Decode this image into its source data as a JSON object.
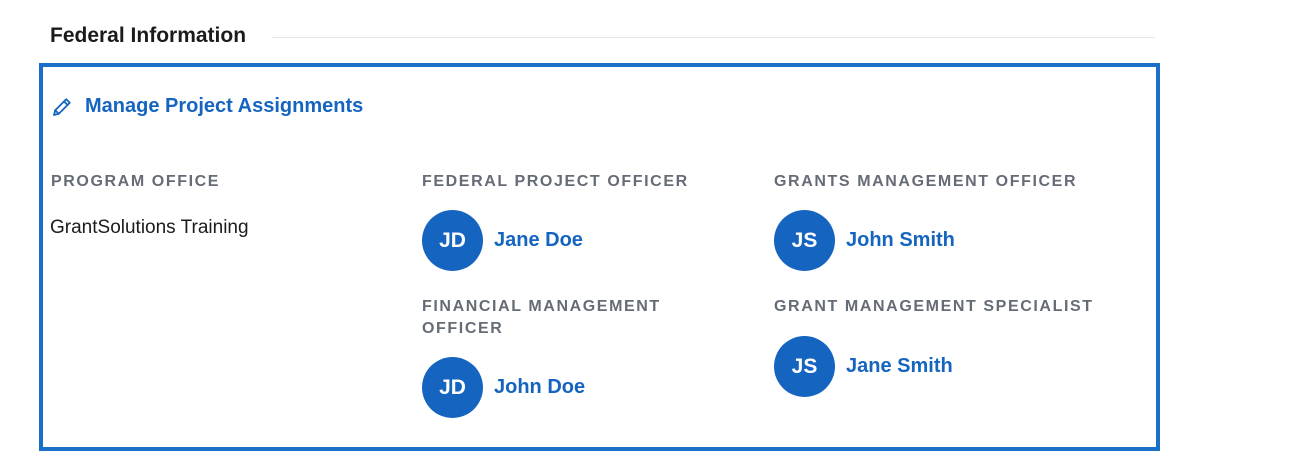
{
  "section": {
    "title": "Federal Information"
  },
  "panel": {
    "manage_link_label": "Manage Project Assignments",
    "manage_link_icon": "pencil-icon",
    "accent_color": "#1565c0",
    "program_office": {
      "label": "PROGRAM OFFICE",
      "value": "GrantSolutions Training"
    },
    "federal_project_officer": {
      "label": "FEDERAL PROJECT OFFICER",
      "initials": "JD",
      "name": "Jane Doe"
    },
    "grants_management_officer": {
      "label": "GRANTS MANAGEMENT OFFICER",
      "initials": "JS",
      "name": "John Smith"
    },
    "financial_management_officer": {
      "label_line1": "FINANCIAL MANAGEMENT",
      "label_line2": "OFFICER",
      "initials": "JD",
      "name": "John Doe"
    },
    "grant_management_specialist": {
      "label": "GRANT MANAGEMENT SPECIALIST",
      "initials": "JS",
      "name": "Jane Smith"
    }
  }
}
